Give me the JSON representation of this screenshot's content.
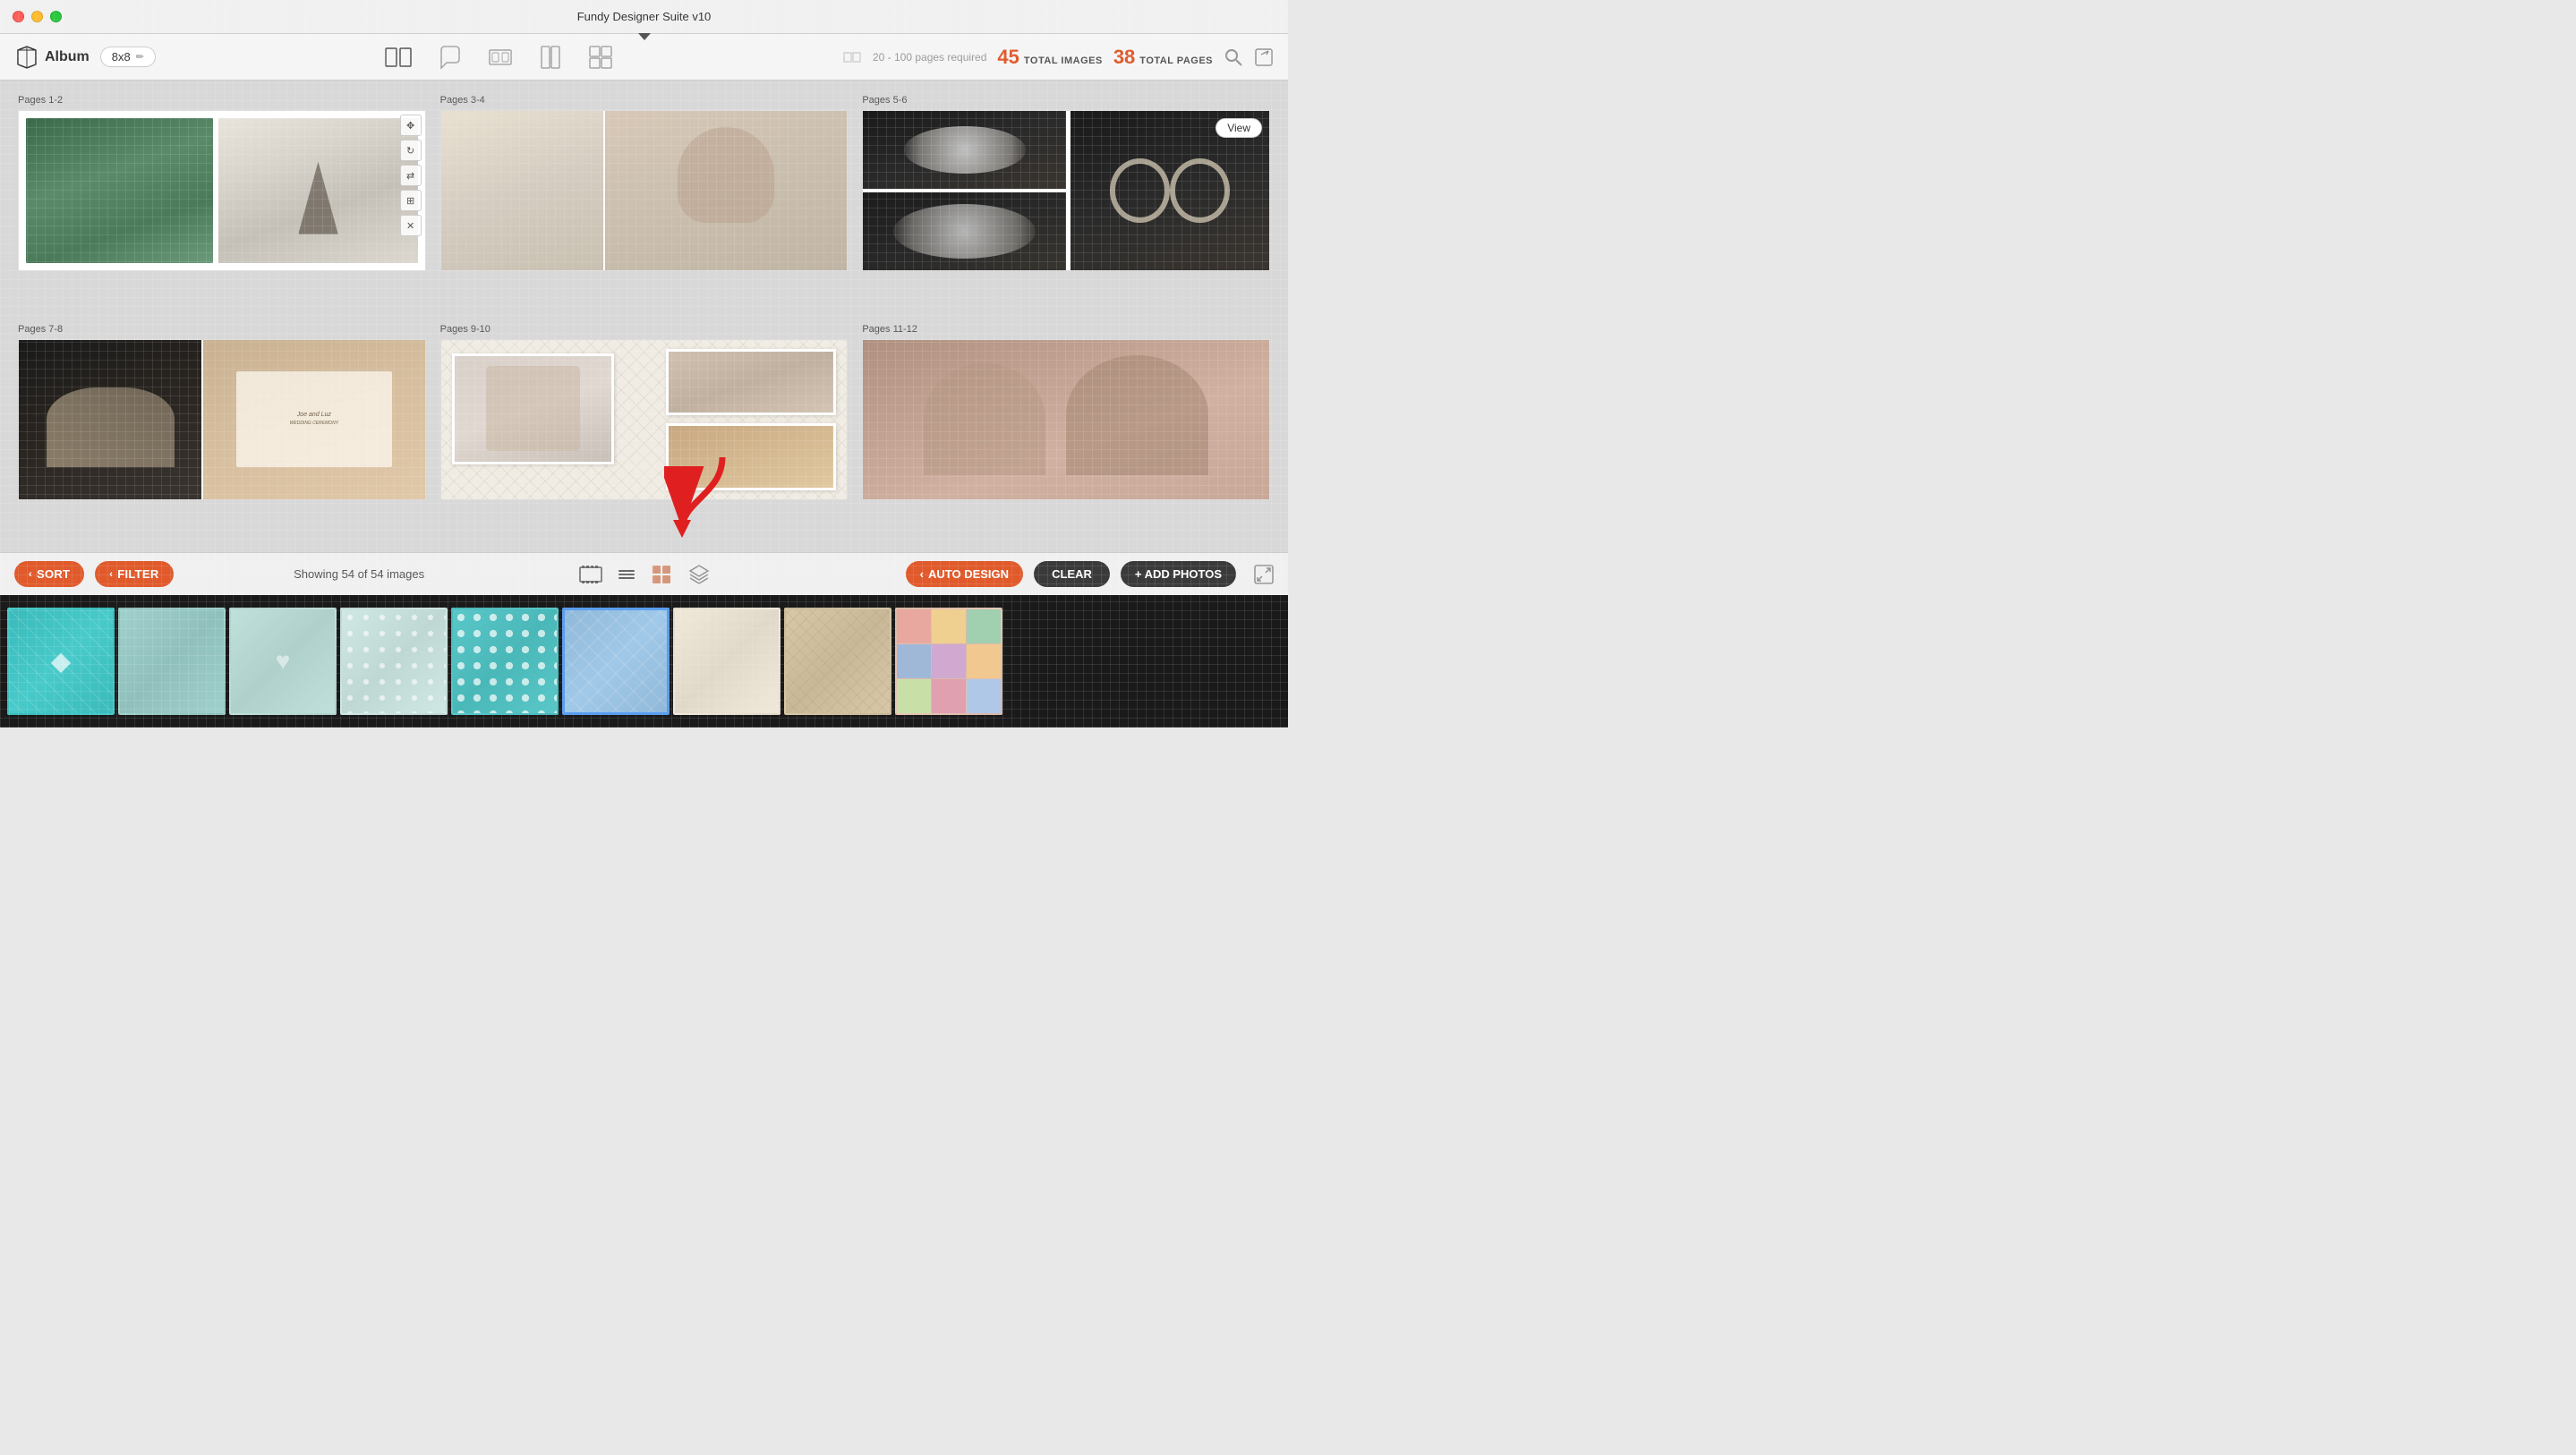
{
  "titlebar": {
    "title": "Fundy Designer Suite v10",
    "traffic_lights": [
      "red",
      "yellow",
      "green"
    ]
  },
  "toolbar": {
    "album_label": "Album",
    "size_badge": "8x8",
    "edit_icon": "✏",
    "center_icons": [
      {
        "name": "album-open-icon",
        "symbol": "⊞",
        "active": true
      },
      {
        "name": "chat-icon",
        "symbol": "💬",
        "active": false
      },
      {
        "name": "people-icon",
        "symbol": "👥",
        "active": false
      },
      {
        "name": "book-icon",
        "symbol": "📖",
        "active": false
      },
      {
        "name": "layout-icon",
        "symbol": "▦",
        "active": false
      }
    ],
    "pages_required": "20 - 100 pages required",
    "total_images_number": "45",
    "total_images_label": "TOTAL IMAGES",
    "total_pages_number": "38",
    "total_pages_label": "TOTAL PAGES",
    "search_icon": "🔍",
    "export_icon": "↗"
  },
  "page_spreads": [
    {
      "id": "spread1",
      "label": "Pages 1-2",
      "has_controls": true
    },
    {
      "id": "spread3",
      "label": "Pages 3-4",
      "has_controls": false
    },
    {
      "id": "spread5",
      "label": "Pages 5-6",
      "has_controls": false,
      "has_view": true
    },
    {
      "id": "spread7",
      "label": "Pages 7-8",
      "has_controls": false
    },
    {
      "id": "spread9",
      "label": "Pages 9-10",
      "has_controls": false,
      "has_arrow": true
    },
    {
      "id": "spread11",
      "label": "Pages 11-12",
      "has_controls": false
    }
  ],
  "bottom_toolbar": {
    "sort_label": "SORT",
    "filter_label": "FILTER",
    "showing_text": "Showing 54 of 54 images",
    "auto_design_label": "AUTO DESIGN",
    "clear_label": "CLEAR",
    "add_photos_label": "+ ADD PHOTOS"
  },
  "photo_strip": {
    "photos": [
      {
        "type": "teal-diamond",
        "selected": false
      },
      {
        "type": "teal-weave",
        "selected": false
      },
      {
        "type": "teal-hearts",
        "selected": false
      },
      {
        "type": "teal-dots-light",
        "selected": false
      },
      {
        "type": "teal-dots",
        "selected": false
      },
      {
        "type": "blue-damask",
        "selected": true
      },
      {
        "type": "beige-plain",
        "selected": false
      },
      {
        "type": "beige-pattern",
        "selected": false
      },
      {
        "type": "multi-color",
        "selected": false
      }
    ]
  }
}
